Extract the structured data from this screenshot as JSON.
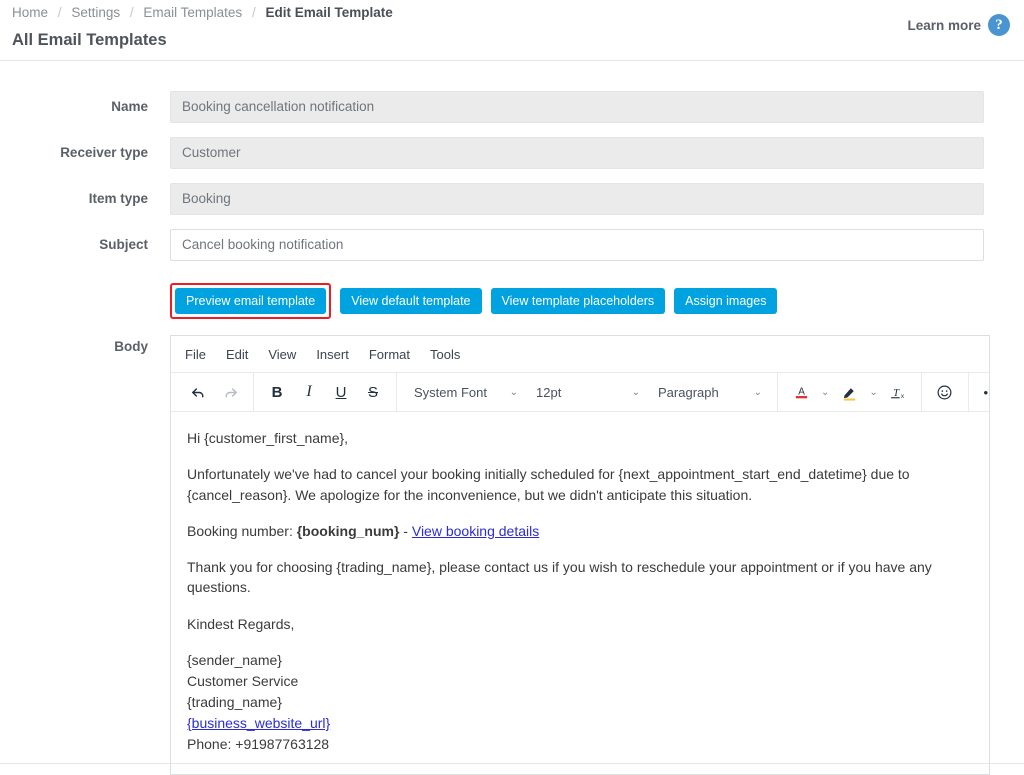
{
  "header": {
    "breadcrumb": [
      {
        "label": "Home",
        "active": false
      },
      {
        "label": "Settings",
        "active": false
      },
      {
        "label": "Email Templates",
        "active": false
      },
      {
        "label": "Edit Email Template",
        "active": true
      }
    ],
    "separator": "/",
    "page_title": "All Email Templates",
    "learn_more_label": "Learn more",
    "help_icon": "question-mark-circle-icon",
    "help_icon_glyph": "?",
    "help_icon_color": "#4a95d1"
  },
  "form": {
    "fields": [
      {
        "label": "Name",
        "value": "Booking cancellation notification",
        "readonly": true
      },
      {
        "label": "Receiver type",
        "value": "Customer",
        "readonly": true
      },
      {
        "label": "Item type",
        "value": "Booking",
        "readonly": true
      },
      {
        "label": "Subject",
        "value": "Cancel booking notification",
        "readonly": false
      }
    ],
    "body_label": "Body"
  },
  "actions": {
    "highlight_color": "#ee1c23",
    "button_color": "#00a3e0",
    "buttons": [
      {
        "label": "Preview email template",
        "highlighted": true
      },
      {
        "label": "View default template",
        "highlighted": false
      },
      {
        "label": "View template placeholders",
        "highlighted": false
      },
      {
        "label": "Assign images",
        "highlighted": false
      }
    ]
  },
  "editor": {
    "menu": [
      "File",
      "Edit",
      "View",
      "Insert",
      "Format",
      "Tools"
    ],
    "toolbar": {
      "undo_icon": "undo-arrow-icon",
      "redo_icon": "redo-arrow-icon",
      "bold": "B",
      "italic": "I",
      "underline": "U",
      "strikethrough": "S",
      "font_family": "System Font",
      "font_size": "12pt",
      "block_format": "Paragraph",
      "text_color_icon": "text-color-icon",
      "highlight_color_icon": "highlight-color-icon",
      "clear_format_icon": "clear-formatting-icon",
      "emoji_icon": "emoji-icon",
      "more_icon": "more-options-icon",
      "caret_glyph": "⌄",
      "more_glyph": "•••"
    },
    "content": {
      "greeting": "Hi {customer_first_name},",
      "paragraph_1": "Unfortunately we've had to cancel your booking initially scheduled for {next_appointment_start_end_datetime} due to {cancel_reason}. We apologize for the inconvenience, but we didn't anticipate this situation.",
      "booking_label": "Booking number: ",
      "booking_placeholder": "{booking_num}",
      "booking_dash": " - ",
      "booking_link": "View booking details",
      "paragraph_2": "Thank you for choosing {trading_name}, please contact us if you wish to reschedule your appointment or if you have any questions.",
      "closing": "Kindest Regards,",
      "sign_sender": "{sender_name}",
      "sign_role": "Customer Service",
      "sign_trading": "{trading_name}",
      "sign_website": "{business_website_url}",
      "sign_phone": "Phone: +91987763128"
    }
  }
}
